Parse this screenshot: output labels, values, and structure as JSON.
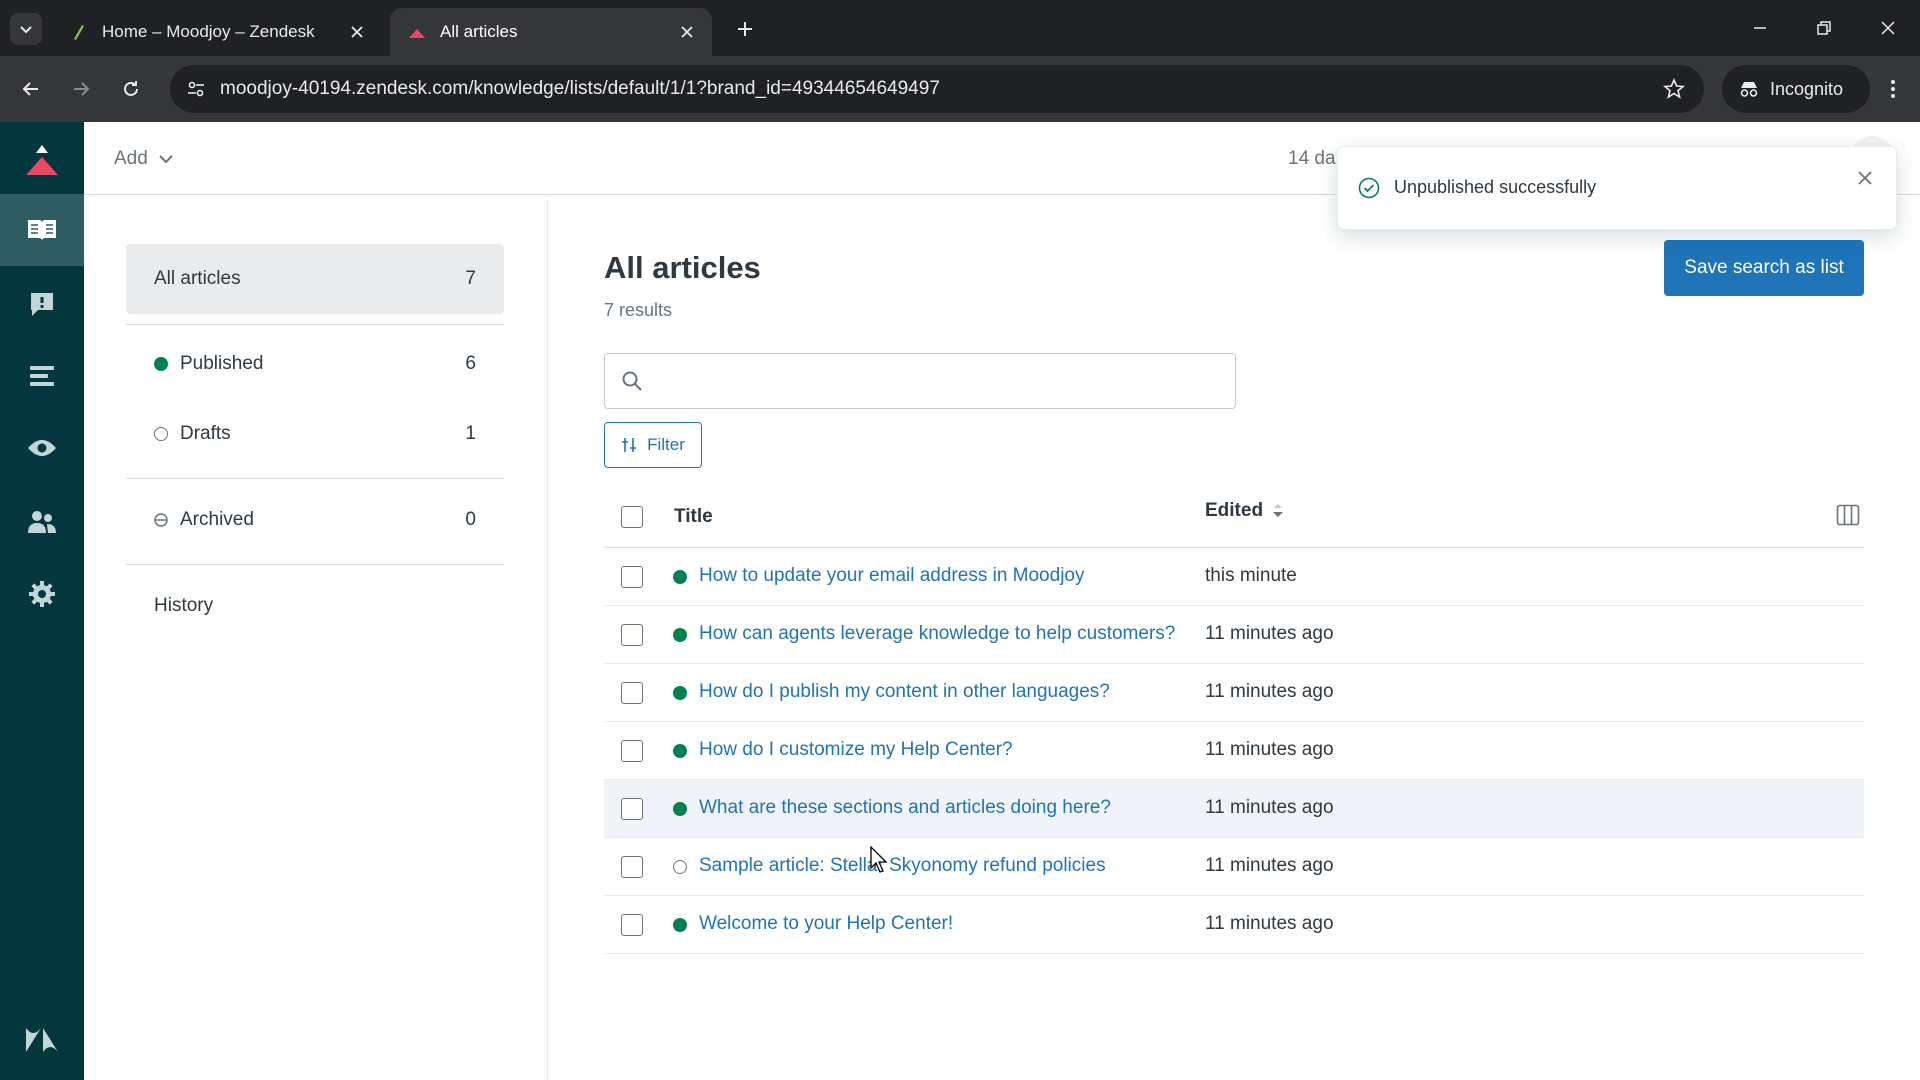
{
  "browser": {
    "tabs": [
      {
        "title": "Home – Moodjoy – Zendesk",
        "active": false
      },
      {
        "title": "All articles",
        "active": true
      }
    ],
    "url": "moodjoy-40194.zendesk.com/knowledge/lists/default/1/1?brand_id=49344654649497",
    "incognito_label": "Incognito"
  },
  "header": {
    "add_label": "Add",
    "trial_text": "14 da"
  },
  "sidebar": {
    "all": {
      "label": "All articles",
      "count": "7"
    },
    "published": {
      "label": "Published",
      "count": "6"
    },
    "drafts": {
      "label": "Drafts",
      "count": "1"
    },
    "archived": {
      "label": "Archived",
      "count": "0"
    },
    "history": "History"
  },
  "main": {
    "title": "All articles",
    "results": "7 results",
    "save_label": "Save search as list",
    "search_placeholder": "",
    "filter_label": "Filter",
    "columns": {
      "title": "Title",
      "edited": "Edited"
    },
    "rows": [
      {
        "title": "How to update your email address in Moodjoy",
        "status": "published",
        "edited": "this minute"
      },
      {
        "title": "How can agents leverage knowledge to help customers?",
        "status": "published",
        "edited": "11 minutes ago"
      },
      {
        "title": "How do I publish my content in other languages?",
        "status": "published",
        "edited": "11 minutes ago"
      },
      {
        "title": "How do I customize my Help Center?",
        "status": "published",
        "edited": "11 minutes ago"
      },
      {
        "title": "What are these sections and articles doing here?",
        "status": "published",
        "edited": "11 minutes ago"
      },
      {
        "title": "Sample article: Stellar Skyonomy refund policies",
        "status": "draft",
        "edited": "11 minutes ago"
      },
      {
        "title": "Welcome to your Help Center!",
        "status": "published",
        "edited": "11 minutes ago"
      }
    ]
  },
  "toast": {
    "message": "Unpublished successfully"
  },
  "colors": {
    "nav_bg": "#03363d",
    "primary": "#1f73b7",
    "published": "#038153"
  }
}
